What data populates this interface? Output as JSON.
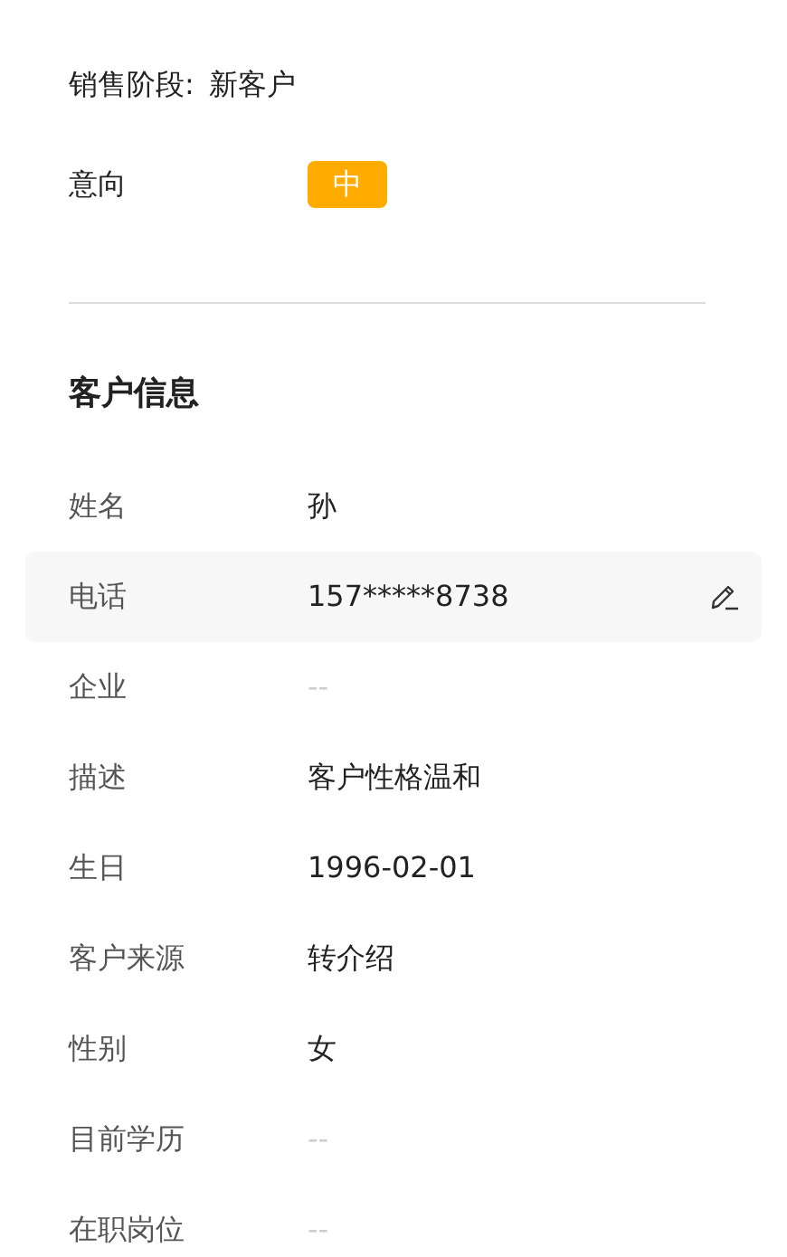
{
  "sales_stage": {
    "label": "销售阶段:",
    "value": "新客户"
  },
  "intent": {
    "label": "意向",
    "badge": "中",
    "color": "#ffab00"
  },
  "customer_info": {
    "title": "客户信息",
    "rows": [
      {
        "label": "姓名",
        "value": "孙",
        "empty": false,
        "selected": false
      },
      {
        "label": "电话",
        "value": "157*****8738",
        "empty": false,
        "selected": true
      },
      {
        "label": "企业",
        "value": "--",
        "empty": true,
        "selected": false
      },
      {
        "label": "描述",
        "value": "客户性格温和",
        "empty": false,
        "selected": false
      },
      {
        "label": "生日",
        "value": "1996-02-01",
        "empty": false,
        "selected": false
      },
      {
        "label": "客户来源",
        "value": "转介绍",
        "empty": false,
        "selected": false
      },
      {
        "label": "性别",
        "value": "女",
        "empty": false,
        "selected": false
      },
      {
        "label": "目前学历",
        "value": "--",
        "empty": true,
        "selected": false
      },
      {
        "label": "在职岗位",
        "value": "--",
        "empty": true,
        "selected": false
      }
    ]
  }
}
